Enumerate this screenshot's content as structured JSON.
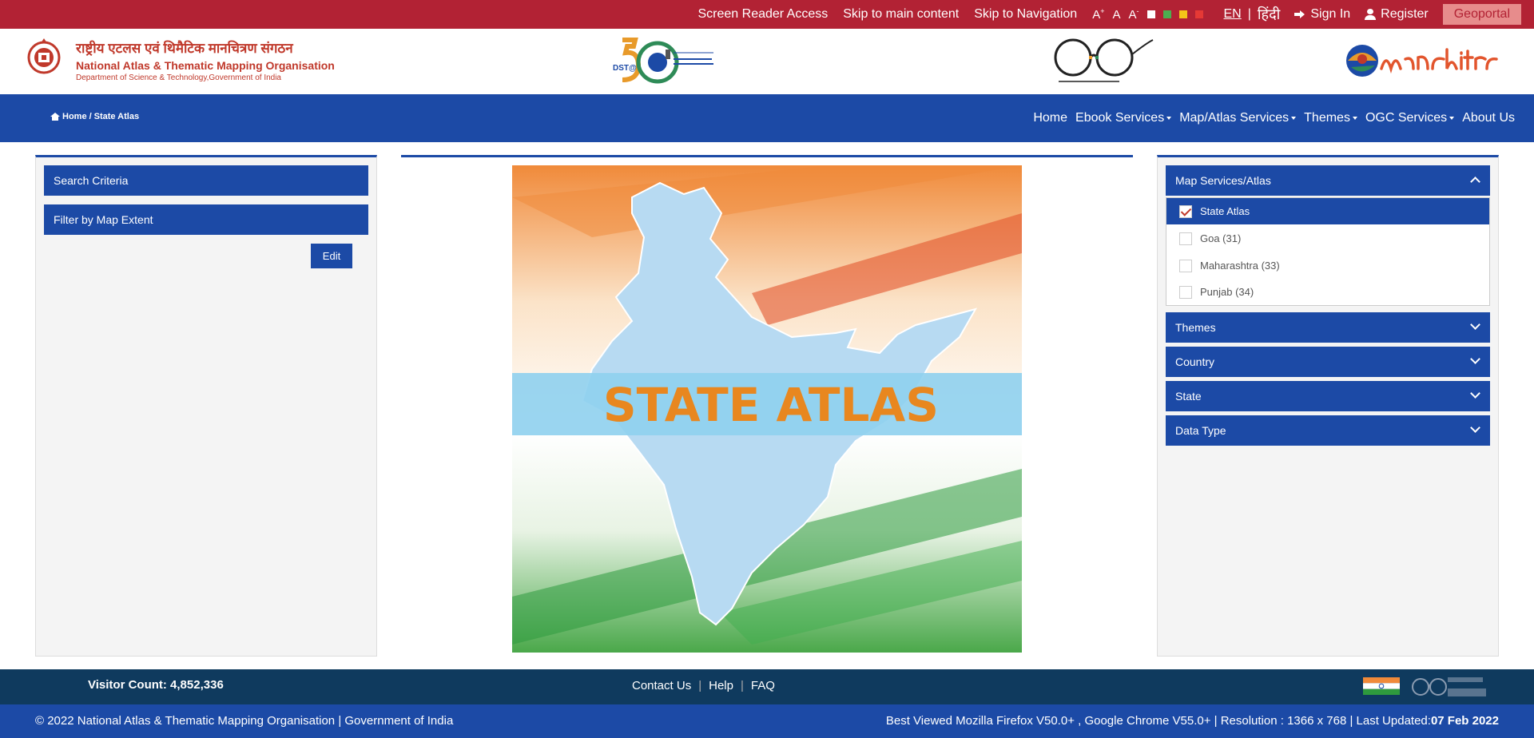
{
  "topbar": {
    "screen_reader": "Screen Reader Access",
    "skip_main": "Skip to main content",
    "skip_nav": "Skip to Navigation",
    "font_increase": "A",
    "font_increase_sup": "+",
    "font_normal": "A",
    "font_decrease": "A",
    "font_decrease_sup": "-",
    "lang_en": "EN",
    "lang_sep": "|",
    "lang_hi": "हिंदी",
    "sign_in": "Sign In",
    "register": "Register",
    "geoportal": "Geoportal",
    "theme_colors": [
      "#ffffff",
      "#4caf50",
      "#f5c518",
      "#e53935"
    ]
  },
  "header": {
    "org_hindi": "राष्ट्रीय एटलस एवं थिमैटिक मानचित्रण संगठन",
    "org_english": "National Atlas & Thematic Mapping Organisation",
    "org_dept": "Department of Science & Technology,Government of India"
  },
  "nav": {
    "breadcrumb_home": "Home",
    "breadcrumb_sep": "/",
    "breadcrumb_current": "State Atlas",
    "menu": [
      "Home",
      "Ebook Services",
      "Map/Atlas Services",
      "Themes",
      "OGC Services",
      "About Us"
    ]
  },
  "left_panel": {
    "search_criteria": "Search Criteria",
    "filter_extent": "Filter by Map Extent",
    "edit": "Edit"
  },
  "banner": {
    "text": "STATE ATLAS"
  },
  "right_panel": {
    "map_services": "Map Services/Atlas",
    "atlas_items": [
      {
        "label": "State Atlas",
        "checked": true
      },
      {
        "label": "Goa (31)",
        "checked": false
      },
      {
        "label": "Maharashtra (33)",
        "checked": false
      },
      {
        "label": "Punjab (34)",
        "checked": false
      }
    ],
    "themes": "Themes",
    "country": "Country",
    "state": "State",
    "data_type": "Data Type"
  },
  "footer": {
    "visitor_count": "Visitor Count: 4,852,336",
    "contact": "Contact Us",
    "help": "Help",
    "faq": "FAQ",
    "sep": "|",
    "copyright": "© 2022 National Atlas & Thematic Mapping Organisation | Government of India",
    "best_viewed": "Best Viewed Mozilla Firefox V50.0+ , Google Chrome V55.0+ | Resolution : 1366 x 768 | Last Updated:",
    "last_updated": "07 Feb 2022"
  },
  "colors": {
    "topbar": "#b22234",
    "nav": "#1c4aa6",
    "footer_dark": "#0f3a5e"
  }
}
